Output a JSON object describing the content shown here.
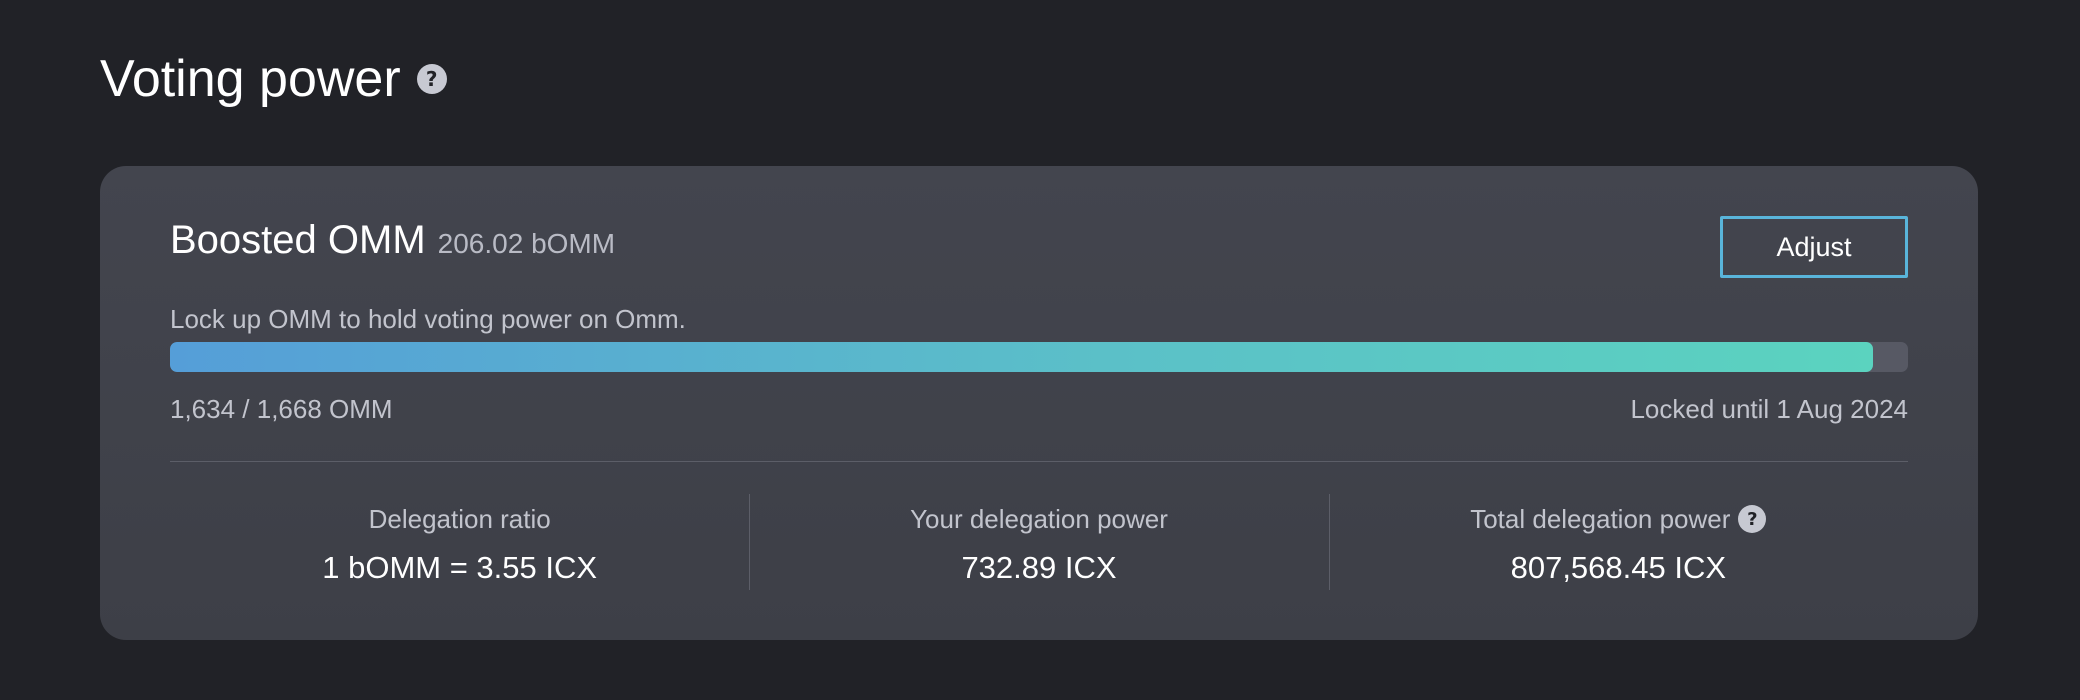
{
  "header": {
    "title": "Voting power",
    "help_icon": "question-circle-icon"
  },
  "card": {
    "name": "Boosted OMM",
    "amount": "206.02 bOMM",
    "description": "Lock up OMM to hold voting power on Omm.",
    "adjust_label": "Adjust",
    "progress": {
      "locked_omm": 1634,
      "total_omm": 1668,
      "fraction": 0.98,
      "label": "1,634 / 1,668 OMM",
      "lock_label": "Locked until 1 Aug 2024"
    },
    "stats": [
      {
        "label": "Delegation ratio",
        "value": "1 bOMM = 3.55 ICX",
        "has_help": false
      },
      {
        "label": "Your delegation power",
        "value": "732.89 ICX",
        "has_help": false
      },
      {
        "label": "Total delegation power",
        "value": "807,568.45 ICX",
        "has_help": true
      }
    ]
  },
  "colors": {
    "background": "#212227",
    "card": "#41434c",
    "accent_start": "#559ed8",
    "accent_end": "#5bd3bf",
    "button_border": "#59b5da"
  }
}
